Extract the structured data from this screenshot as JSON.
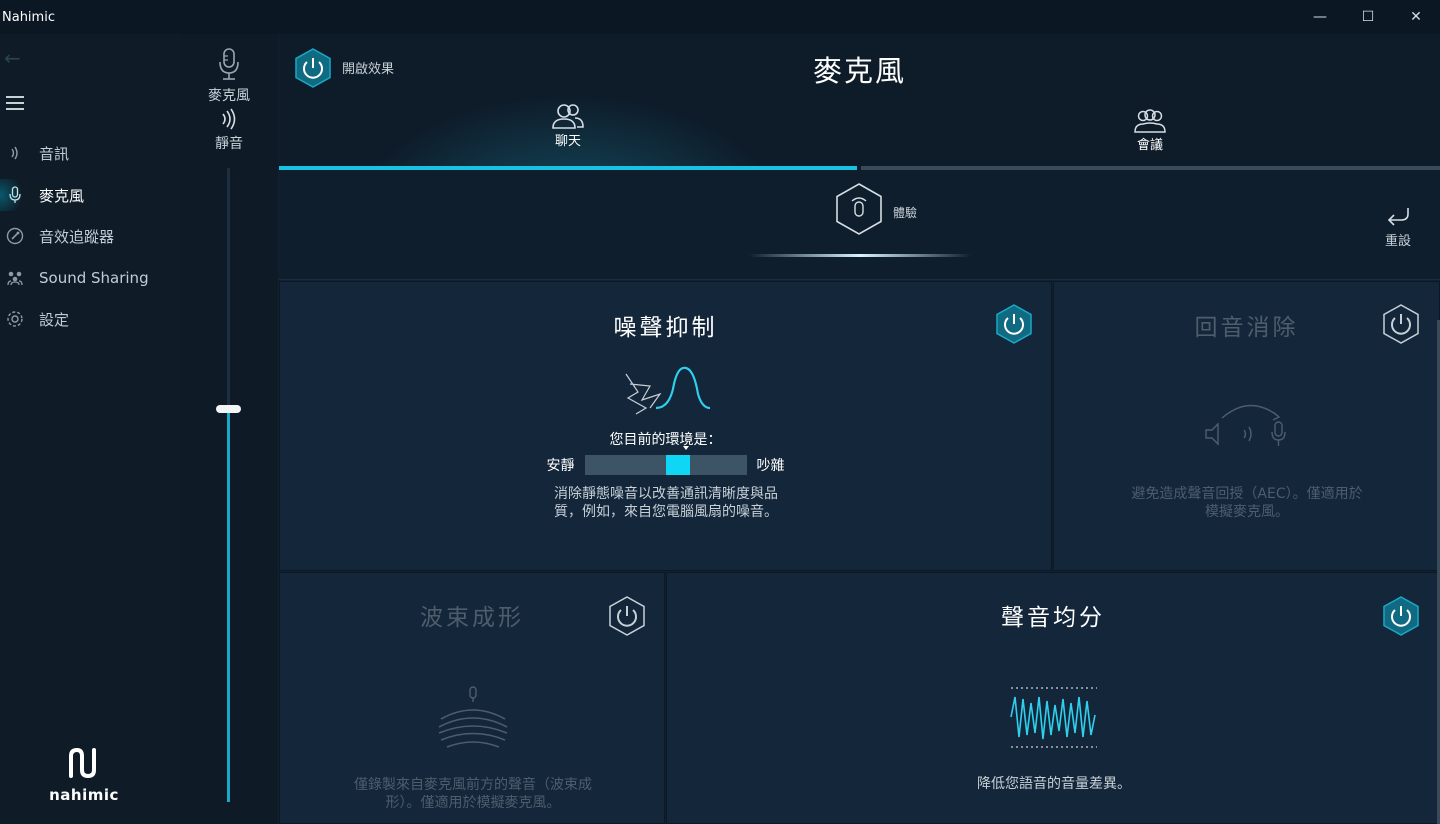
{
  "window": {
    "title": "Nahimic",
    "minimize": "—",
    "maximize": "☐",
    "close": "✕"
  },
  "sidebar": {
    "items": [
      {
        "label": "音訊",
        "icon": "speaker-waves-icon"
      },
      {
        "label": "麥克風",
        "icon": "microphone-icon"
      },
      {
        "label": "音效追蹤器",
        "icon": "sound-tracker-icon"
      },
      {
        "label": "Sound Sharing",
        "icon": "sound-sharing-icon"
      },
      {
        "label": "設定",
        "icon": "gear-icon"
      }
    ],
    "logo_text": "nahimic"
  },
  "level": {
    "mic_label": "麥克風",
    "mute_label": "靜音",
    "volume_fraction": 0.62
  },
  "header": {
    "enable_label": "開啟效果",
    "title": "麥克風",
    "tabs": [
      {
        "label": "聊天"
      },
      {
        "label": "會議"
      }
    ]
  },
  "preset": {
    "label": "體驗",
    "reset_label": "重設"
  },
  "cards": {
    "noise": {
      "title": "噪聲抑制",
      "env_label": "您目前的環境是：",
      "env_low": "安靜",
      "env_high": "吵雜",
      "env_level": 0.5,
      "desc": "消除靜態噪音以改善通訊清晰度與品質，例如，來自您電腦風扇的噪音。"
    },
    "echo": {
      "title": "回音消除",
      "desc": "避免造成聲音回授（AEC）。僅適用於模擬麥克風。"
    },
    "beam": {
      "title": "波束成形",
      "desc": "僅錄製來自麥克風前方的聲音（波束成形）。僅適用於模擬麥克風。"
    },
    "leveler": {
      "title": "聲音均分",
      "desc": "降低您語音的音量差異。"
    }
  },
  "colors": {
    "accent": "#17c2e3",
    "power_active": "#0f6a82",
    "background": "#112131"
  }
}
